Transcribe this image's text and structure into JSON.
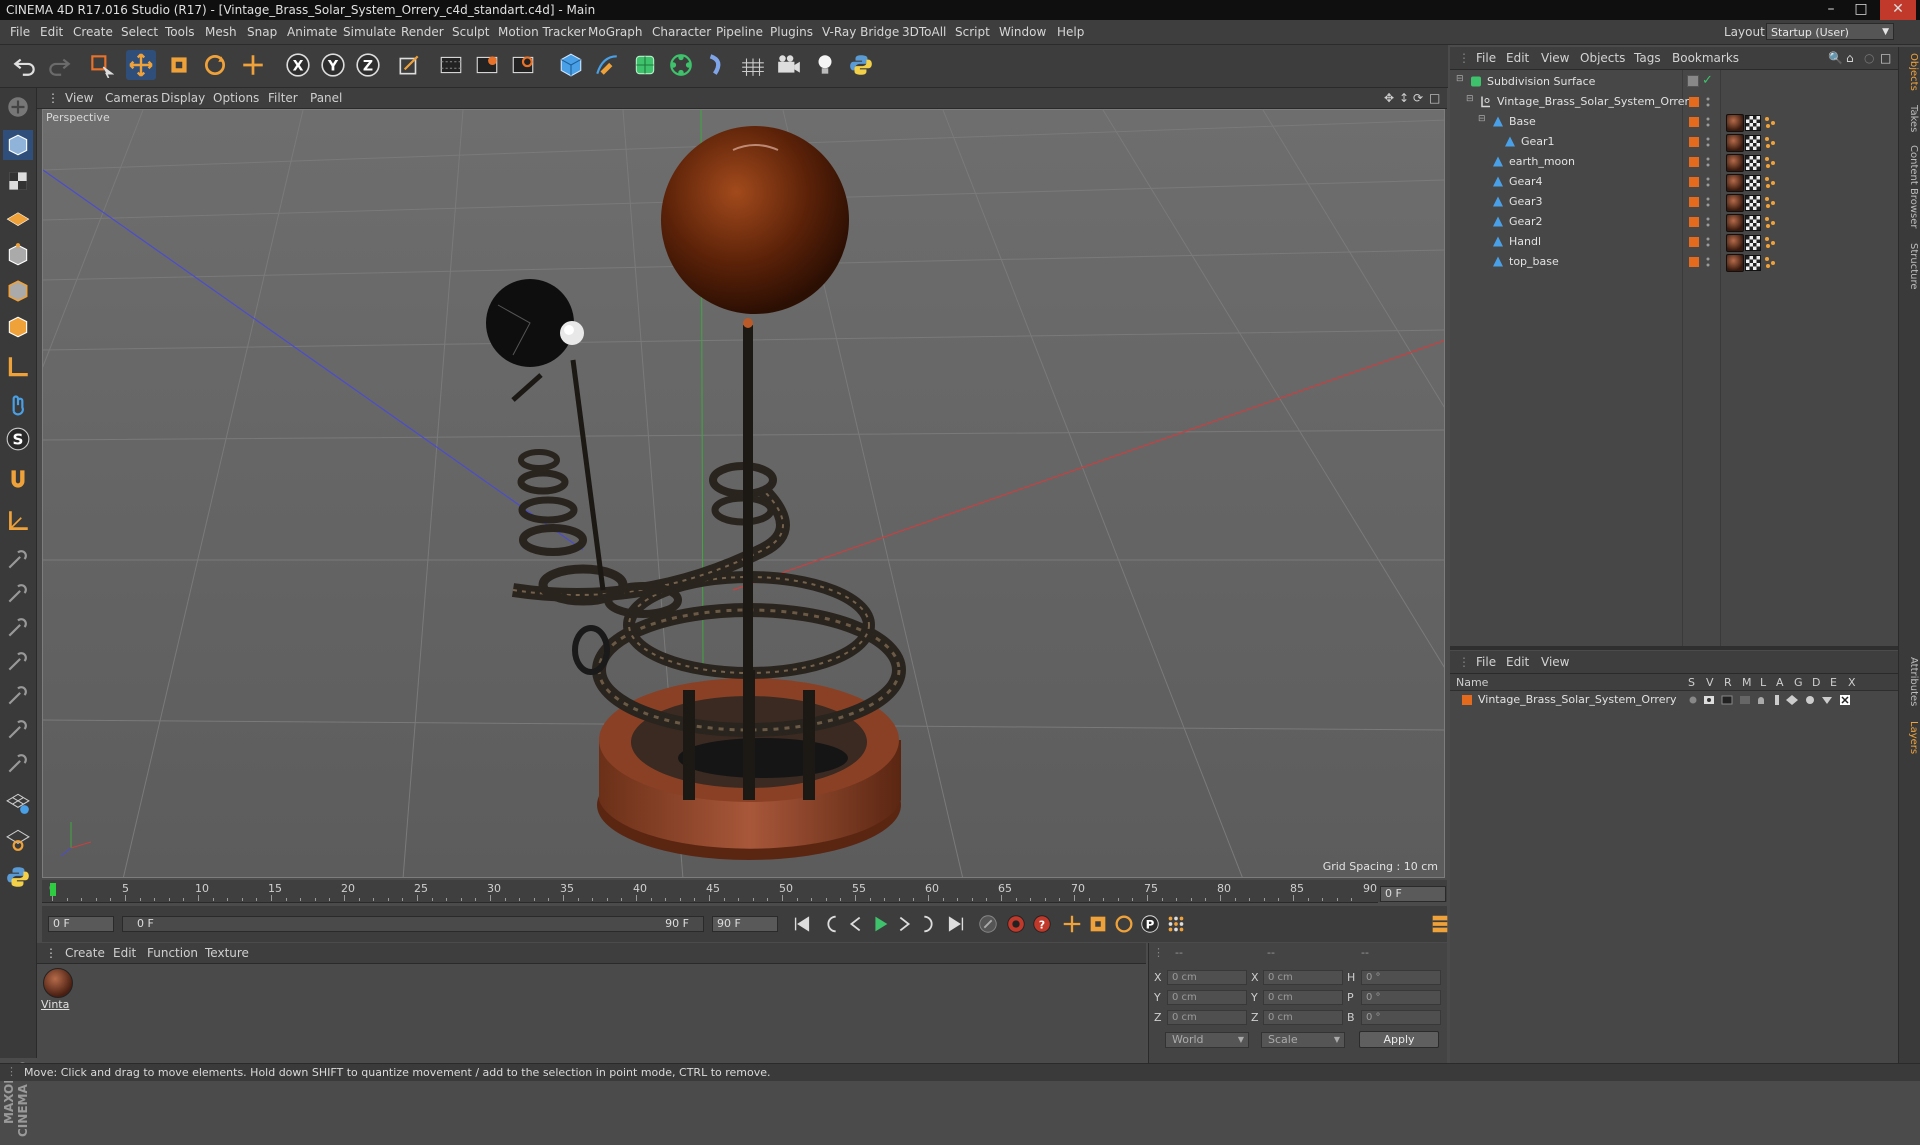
{
  "window": {
    "title": "CINEMA 4D R17.016 Studio (R17) - [Vintage_Brass_Solar_System_Orrery_c4d_standart.c4d] - Main"
  },
  "menubar": {
    "items": [
      "File",
      "Edit",
      "Create",
      "Select",
      "Tools",
      "Mesh",
      "Snap",
      "Animate",
      "Simulate",
      "Render",
      "Sculpt",
      "Motion Tracker",
      "MoGraph",
      "Character",
      "Pipeline",
      "Plugins",
      "V-Ray Bridge",
      "3DToAll",
      "Script",
      "Window",
      "Help"
    ],
    "layout_label": "Layout:",
    "layout_value": "Startup (User)"
  },
  "toolbar": {
    "icons": [
      "undo-icon",
      "redo-icon",
      "live-selection-icon",
      "move-icon",
      "scale-icon",
      "rotate-icon",
      "last-tool-icon",
      "x-axis-lock-icon",
      "y-axis-lock-icon",
      "z-axis-lock-icon",
      "world-coordinates-icon",
      "render-view-icon",
      "render-picture-viewer-icon",
      "edit-render-settings-icon",
      "cube-icon",
      "pen-spline-icon",
      "subdivision-surface-icon",
      "array-icon",
      "deformer-icon",
      "floor-icon",
      "camera-icon",
      "light-icon",
      "python-icon"
    ]
  },
  "viewport": {
    "menu": [
      "View",
      "Cameras",
      "Display",
      "Options",
      "Filter",
      "Panel"
    ],
    "label": "Perspective",
    "grid_spacing": "Grid Spacing : 10 cm"
  },
  "timeline": {
    "ticks": [
      "0",
      "5",
      "10",
      "15",
      "20",
      "25",
      "30",
      "35",
      "40",
      "45",
      "50",
      "55",
      "60",
      "65",
      "70",
      "75",
      "80",
      "85",
      "90"
    ],
    "end_frame": "0 F",
    "current_frame": "0 F",
    "range_start": "0 F",
    "range_end": "90 F",
    "max_frame": "90 F"
  },
  "material_panel": {
    "menu": [
      "Create",
      "Edit",
      "Function",
      "Texture"
    ],
    "material_name": "Vinta"
  },
  "coordinates": {
    "header": [
      "--",
      "--",
      "--"
    ],
    "rows": [
      {
        "axis": "X",
        "pos": "0 cm",
        "axis2": "X",
        "size": "0 cm",
        "axis3": "H",
        "rot": "0 °"
      },
      {
        "axis": "Y",
        "pos": "0 cm",
        "axis2": "Y",
        "size": "0 cm",
        "axis3": "P",
        "rot": "0 °"
      },
      {
        "axis": "Z",
        "pos": "0 cm",
        "axis2": "Z",
        "size": "0 cm",
        "axis3": "B",
        "rot": "0 °"
      }
    ],
    "mode": "World",
    "size_mode": "Scale",
    "apply": "Apply"
  },
  "status": {
    "text": "Move: Click and drag to move elements. Hold down SHIFT to quantize movement / add to the selection in point mode, CTRL to remove."
  },
  "object_manager": {
    "menu": [
      "File",
      "Edit",
      "View",
      "Objects",
      "Tags",
      "Bookmarks"
    ],
    "objects": [
      {
        "name": "Subdivision Surface",
        "type": "subdivision",
        "level": 0,
        "tags": false
      },
      {
        "name": "Vintage_Brass_Solar_System_Orrery",
        "type": "null",
        "level": 1,
        "tags": false
      },
      {
        "name": "Base",
        "type": "polygon",
        "level": 2,
        "tags": true
      },
      {
        "name": "Gear1",
        "type": "polygon",
        "level": 3,
        "tags": true
      },
      {
        "name": "earth_moon",
        "type": "polygon",
        "level": 2,
        "tags": true
      },
      {
        "name": "Gear4",
        "type": "polygon",
        "level": 2,
        "tags": true
      },
      {
        "name": "Gear3",
        "type": "polygon",
        "level": 2,
        "tags": true
      },
      {
        "name": "Gear2",
        "type": "polygon",
        "level": 2,
        "tags": true
      },
      {
        "name": "Handl",
        "type": "polygon",
        "level": 2,
        "tags": true
      },
      {
        "name": "top_base",
        "type": "polygon",
        "level": 2,
        "tags": true
      }
    ]
  },
  "layer_manager": {
    "menu": [
      "File",
      "Edit",
      "View"
    ],
    "columns": [
      "Name",
      "S",
      "V",
      "R",
      "M",
      "L",
      "A",
      "G",
      "D",
      "E",
      "X"
    ],
    "layers": [
      {
        "name": "Vintage_Brass_Solar_System_Orrery",
        "color": "#e46a1e"
      }
    ]
  },
  "right_tabs": [
    "Objects",
    "Takes",
    "Content Browser",
    "Structure",
    "Attributes",
    "Layers"
  ],
  "colors": {
    "accent": "#e46a1e",
    "selection_blue": "#4d8fd6",
    "viewport_bg": "#6a6a6a"
  }
}
